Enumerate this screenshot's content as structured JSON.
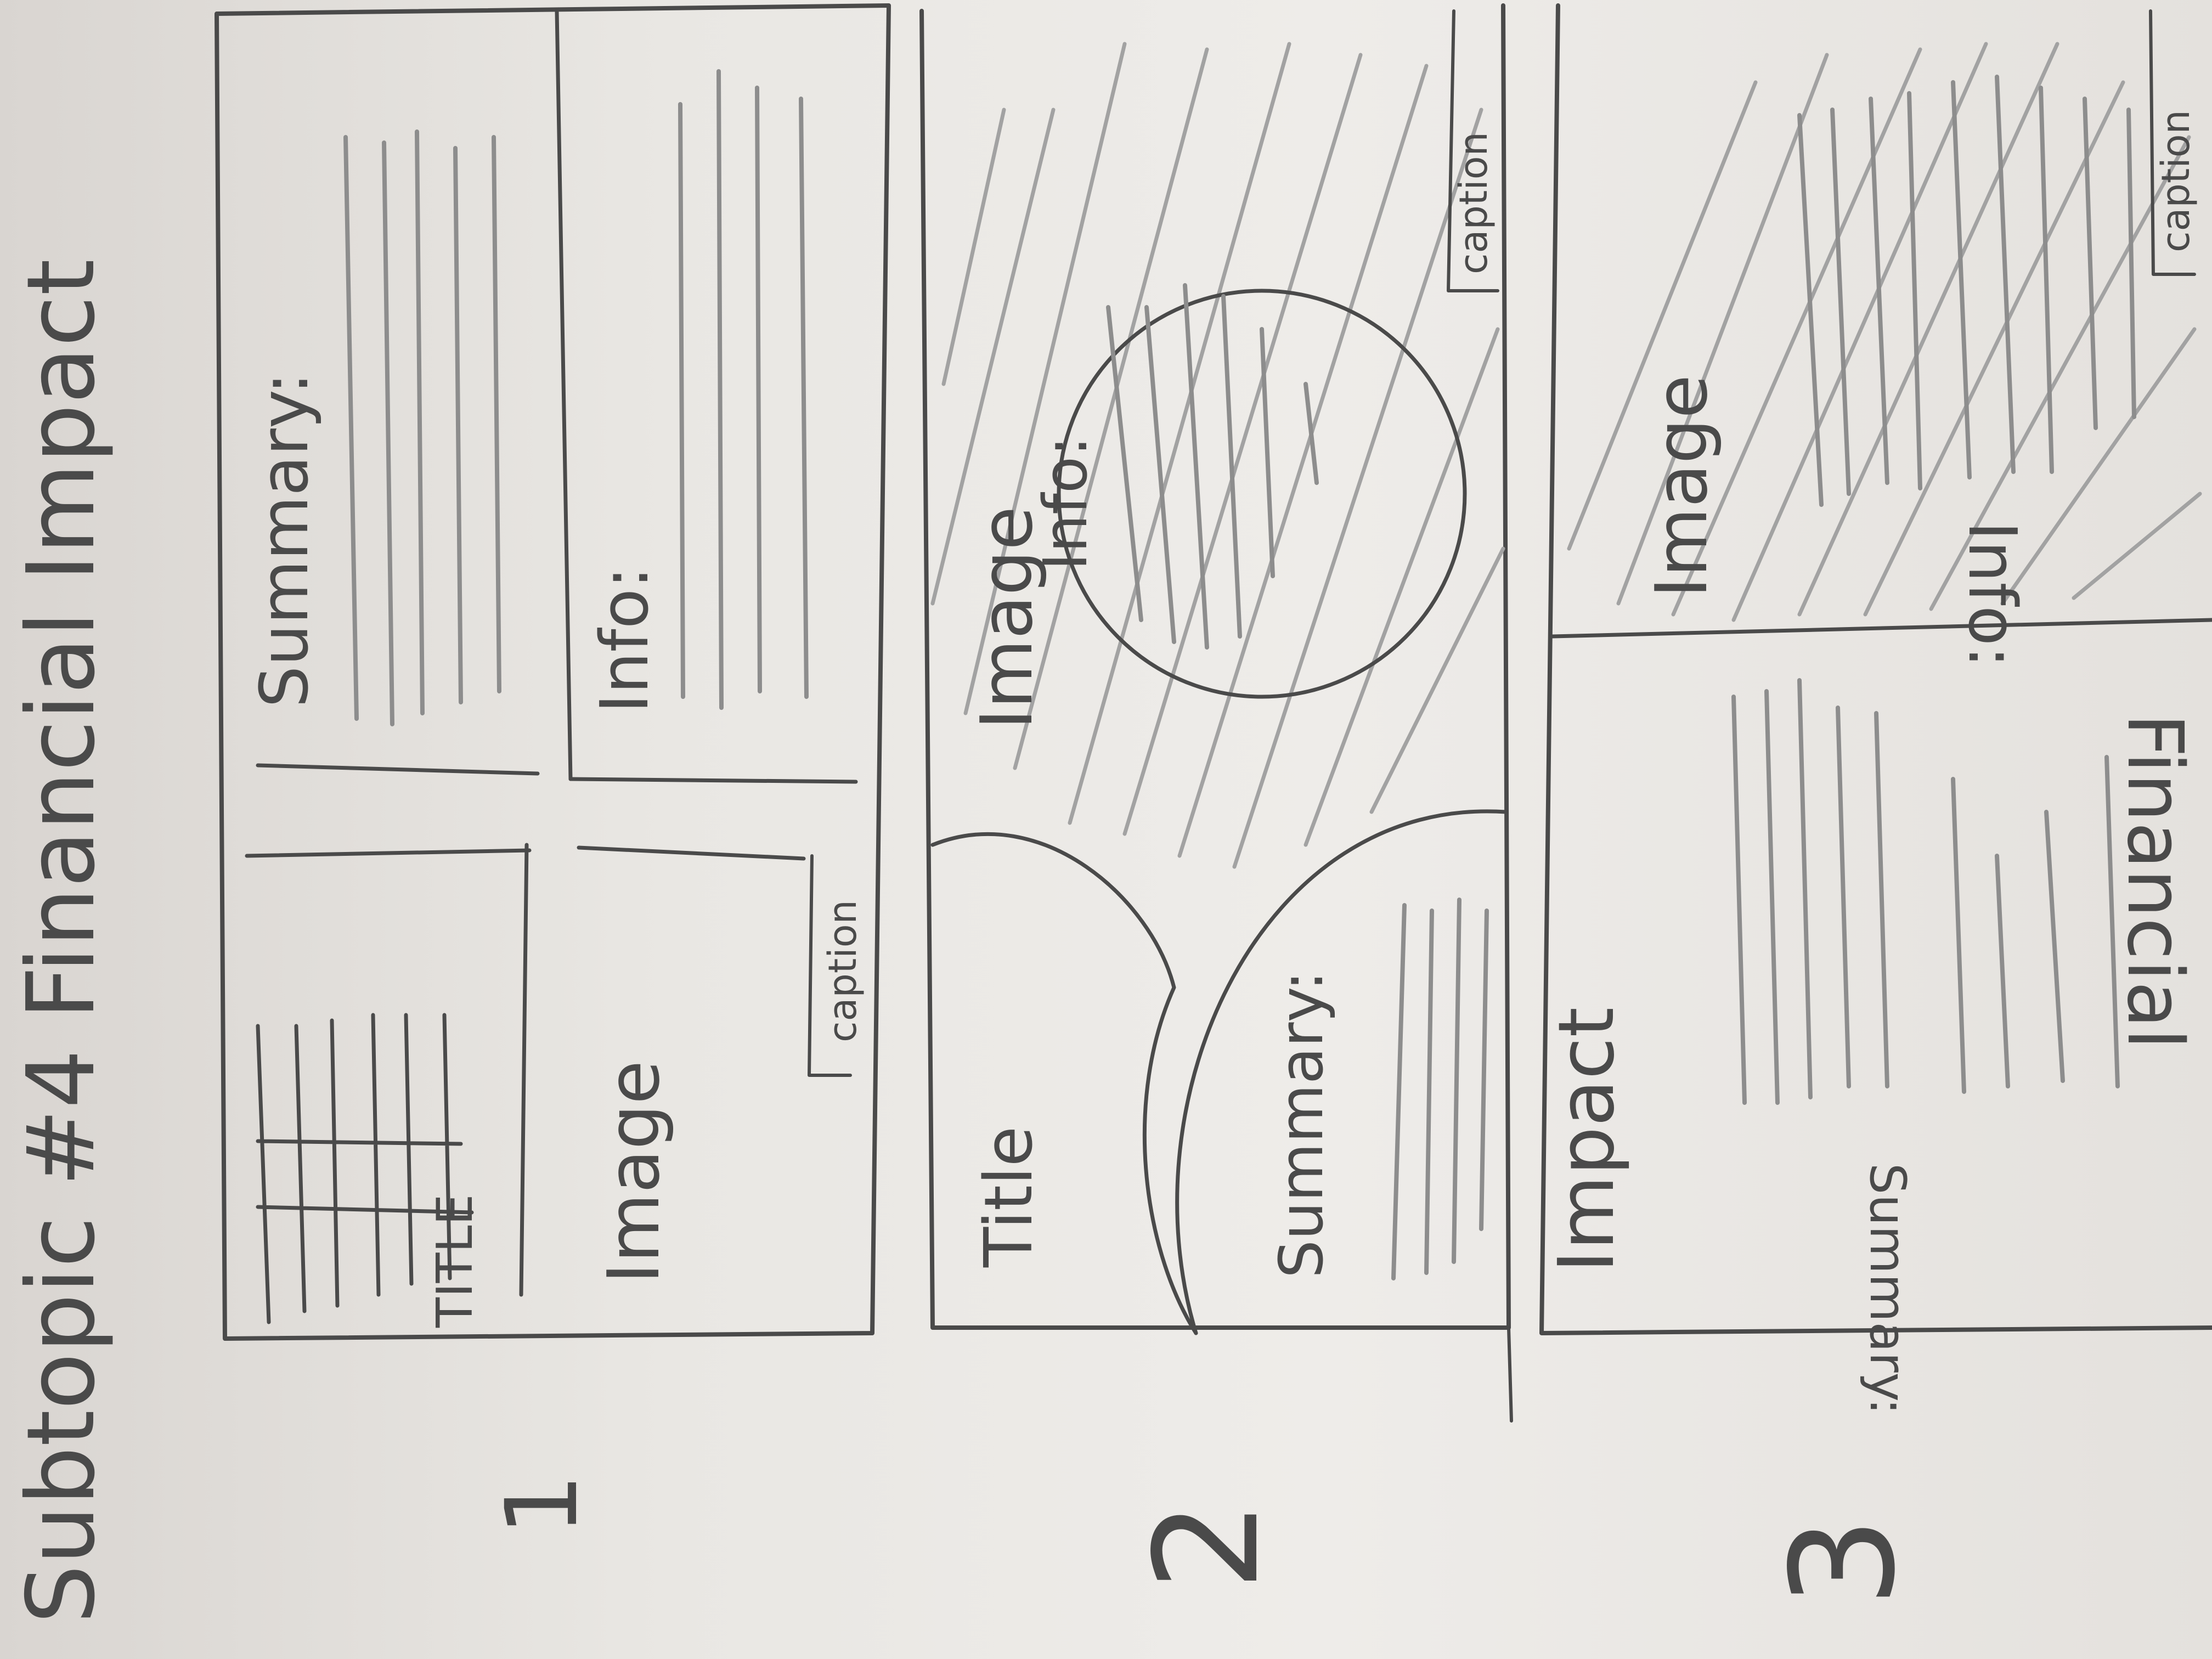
{
  "heading": "Subtopic #4 Financial Impact",
  "panels": [
    {
      "number": "1",
      "title": "TITLE",
      "image_label": "Image",
      "summary_label": "Summary:",
      "info_label": "Info:",
      "caption_label": "caption"
    },
    {
      "number": "2",
      "title": "Title",
      "image_label": "Image",
      "summary_label": "Summary:",
      "info_label": "Info:",
      "caption_label": "caption"
    },
    {
      "number": "3",
      "title_line1": "Financial",
      "title_line2": "Impact",
      "image_label": "Image",
      "summary_label": "Summary:",
      "info_label": "Info:",
      "caption_label": "caption"
    }
  ],
  "colors": {
    "paper": "#e9e7e3",
    "ink": "#4a4a4a",
    "pencil": "#8d8d8d"
  }
}
